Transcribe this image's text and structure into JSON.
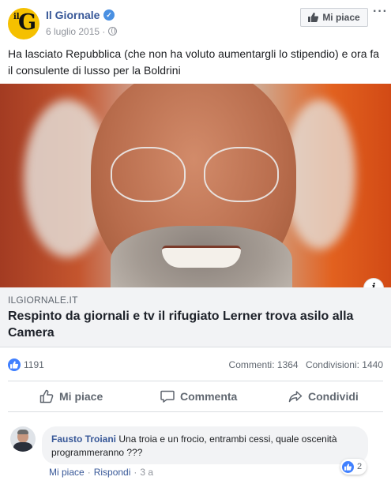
{
  "page": {
    "logo_text_small": "il",
    "logo_text_large": "G",
    "name": "Il Giornale",
    "date": "6 luglio 2015",
    "date_separator": "·",
    "like_button": "Mi piace",
    "more_icon": "···"
  },
  "post": {
    "text": "Ha lasciato Repubblica (che non ha voluto aumentargli lo stipendio) e ora fa il consulente di lusso per la Boldrini"
  },
  "link": {
    "domain": "ILGIORNALE.IT",
    "title": "Respinto da giornali e tv il rifugiato Lerner trova asilo alla Camera",
    "info_icon": "i"
  },
  "stats": {
    "likes": "1191",
    "comments": "Commenti: 1364",
    "shares": "Condivisioni: 1440"
  },
  "actions": {
    "like": "Mi piace",
    "comment": "Commenta",
    "share": "Condividi"
  },
  "comment": {
    "author": "Fausto Troiani",
    "text": "Una troia e un frocio, entrambi cessi, quale oscenità programmeranno ???",
    "like_link": "Mi piace",
    "separator": "·",
    "reply_link": "Rispondi",
    "time": "3 a",
    "reaction_count": "2"
  },
  "colors": {
    "brand_blue": "#385898",
    "like_blue": "#4080ff",
    "logo_yellow": "#f5c000"
  }
}
